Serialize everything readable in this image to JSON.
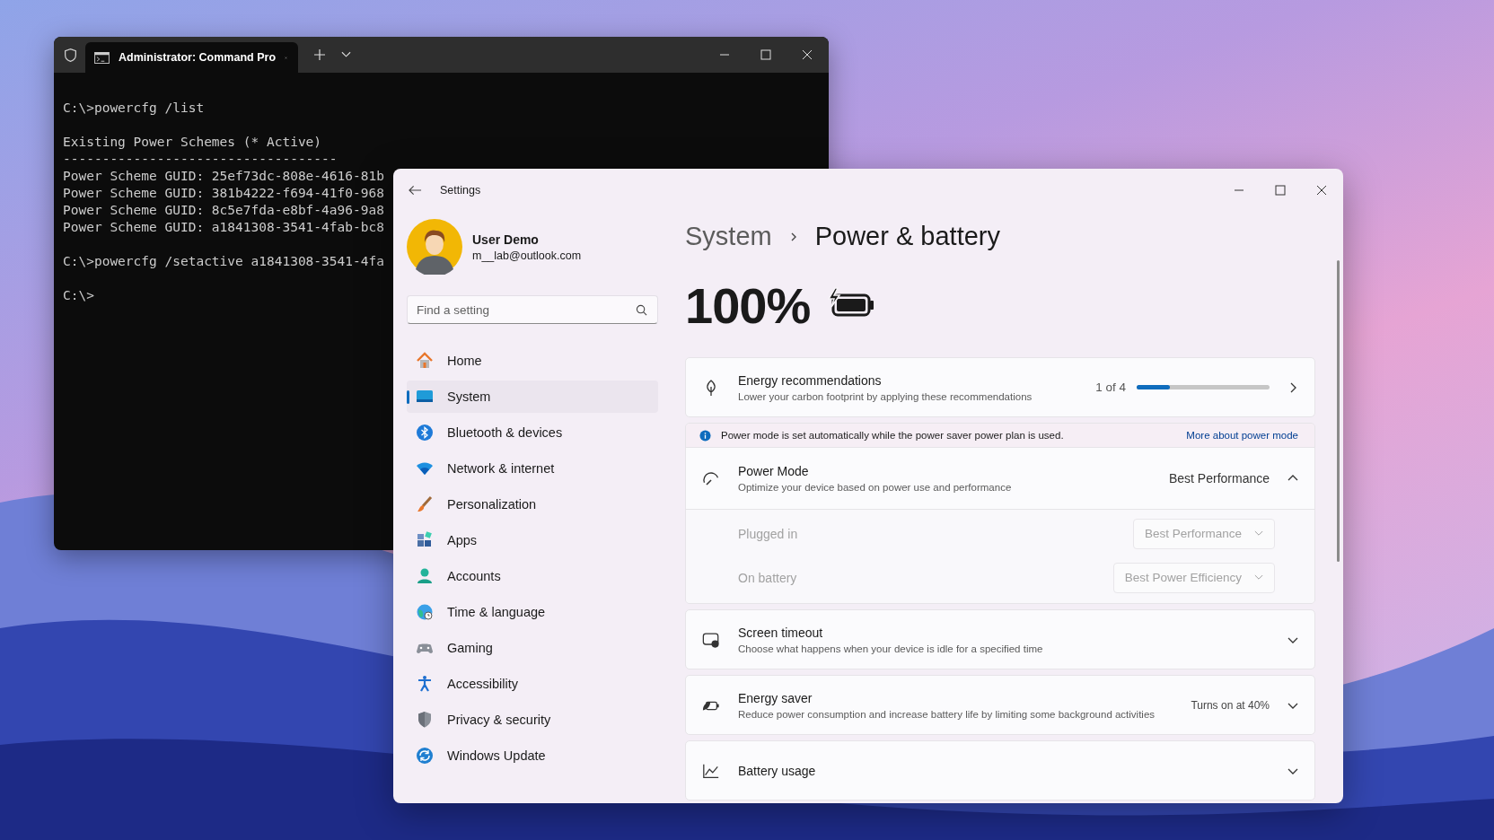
{
  "terminal": {
    "tab_title": "Administrator: Command Pro",
    "blocks": [
      [
        "C:\\>powercfg /list"
      ],
      [
        "Existing Power Schemes (* Active)",
        "-----------------------------------",
        "Power Scheme GUID: 25ef73dc-808e-4616-81b",
        "Power Scheme GUID: 381b4222-f694-41f0-968",
        "Power Scheme GUID: 8c5e7fda-e8bf-4a96-9a8",
        "Power Scheme GUID: a1841308-3541-4fab-bc8"
      ],
      [
        "C:\\>powercfg /setactive a1841308-3541-4fa"
      ],
      [
        "C:\\>"
      ]
    ]
  },
  "settings": {
    "title": "Settings",
    "user": {
      "name": "User Demo",
      "email": "m__lab@outlook.com"
    },
    "search": {
      "placeholder": "Find a setting"
    },
    "nav": [
      {
        "label": "Home",
        "selected": false
      },
      {
        "label": "System",
        "selected": true
      },
      {
        "label": "Bluetooth & devices",
        "selected": false
      },
      {
        "label": "Network & internet",
        "selected": false
      },
      {
        "label": "Personalization",
        "selected": false
      },
      {
        "label": "Apps",
        "selected": false
      },
      {
        "label": "Accounts",
        "selected": false
      },
      {
        "label": "Time & language",
        "selected": false
      },
      {
        "label": "Gaming",
        "selected": false
      },
      {
        "label": "Accessibility",
        "selected": false
      },
      {
        "label": "Privacy & security",
        "selected": false
      },
      {
        "label": "Windows Update",
        "selected": false
      }
    ],
    "breadcrumb": {
      "parent": "System",
      "current": "Power & battery"
    },
    "battery_percent": "100%",
    "energy_recommendations": {
      "title": "Energy recommendations",
      "description": "Lower your carbon footprint by applying these recommendations",
      "progress_text": "1 of 4",
      "level": 0.25
    },
    "info_bar": {
      "text": "Power mode is set automatically while the power saver power plan is used.",
      "link": "More about power mode"
    },
    "power_mode": {
      "title": "Power Mode",
      "description": "Optimize your device based on power use and performance",
      "value": "Best Performance",
      "expanded": true,
      "options": [
        {
          "label": "Plugged in",
          "value": "Best Performance",
          "disabled": true
        },
        {
          "label": "On battery",
          "value": "Best Power Efficiency",
          "disabled": true
        }
      ]
    },
    "cards": [
      {
        "title": "Screen timeout",
        "description": "Choose what happens when your device is idle for a specified time",
        "expanded": false
      },
      {
        "title": "Energy saver",
        "description": "Reduce power consumption and increase battery life by limiting some background activities",
        "value": "Turns on at 40%",
        "expanded": false
      },
      {
        "title": "Battery usage",
        "expanded": false
      }
    ]
  }
}
